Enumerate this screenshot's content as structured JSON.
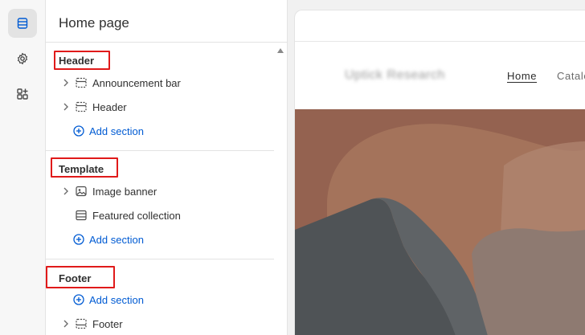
{
  "sidebar_rail": {
    "items": [
      {
        "icon": "sections-icon",
        "active": true
      },
      {
        "icon": "gear-icon",
        "active": false
      },
      {
        "icon": "apps-icon",
        "active": false
      }
    ]
  },
  "panel": {
    "title": "Home page",
    "groups": {
      "header": {
        "label": "Header",
        "items": [
          "Announcement bar",
          "Header"
        ],
        "add_label": "Add section"
      },
      "template": {
        "label": "Template",
        "items": [
          "Image banner",
          "Featured collection"
        ],
        "add_label": "Add section"
      },
      "footer": {
        "label": "Footer",
        "add_label": "Add section",
        "items": [
          "Footer"
        ]
      }
    }
  },
  "preview": {
    "store_name": "Uptick Research",
    "nav": {
      "home": "Home",
      "catalog": "Catalo"
    }
  },
  "colors": {
    "accent": "#005bd3",
    "highlight": "#e01a1a"
  }
}
